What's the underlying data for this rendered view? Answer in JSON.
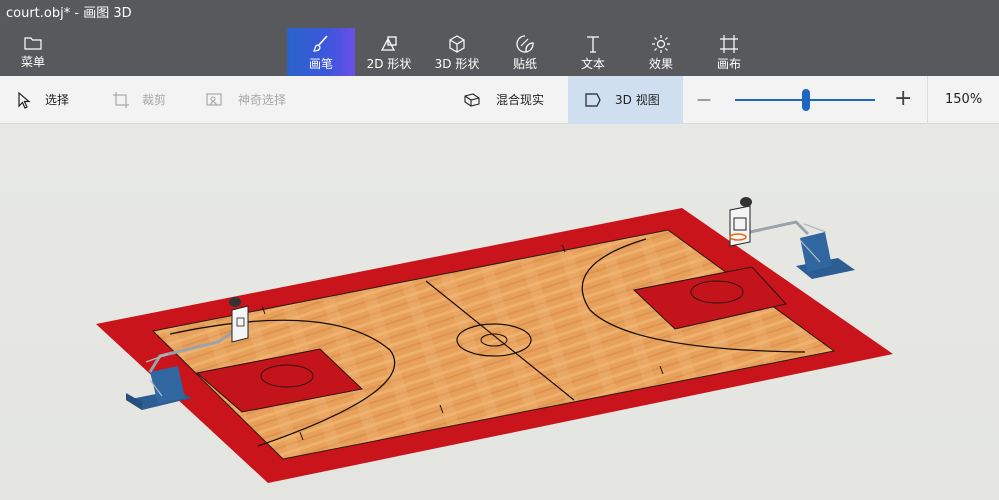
{
  "window": {
    "title": "court.obj* - 画图 3D"
  },
  "ribbon": {
    "menu_label": "菜单",
    "tools": [
      {
        "label": "画笔",
        "icon": "brush-icon",
        "active": true
      },
      {
        "label": "2D 形状",
        "icon": "2d-shapes-icon"
      },
      {
        "label": "3D 形状",
        "icon": "3d-shapes-icon"
      },
      {
        "label": "贴纸",
        "icon": "stickers-icon"
      },
      {
        "label": "文本",
        "icon": "text-icon"
      },
      {
        "label": "效果",
        "icon": "effects-icon"
      },
      {
        "label": "画布",
        "icon": "canvas-icon"
      }
    ]
  },
  "toolbar": {
    "select_label": "选择",
    "crop_label": "裁剪",
    "magic_select_label": "神奇选择",
    "mixed_reality_label": "混合现实",
    "view3d_label": "3D 视图",
    "zoom_minus": "—",
    "zoom_plus": "+",
    "zoom_value": "150%",
    "zoom_fraction": 0.5
  },
  "colors": {
    "ribbon_bg": "#58595c",
    "accent": "#1f66c1",
    "court_border_red": "#c8141a",
    "court_wood": "#e9a45e"
  }
}
